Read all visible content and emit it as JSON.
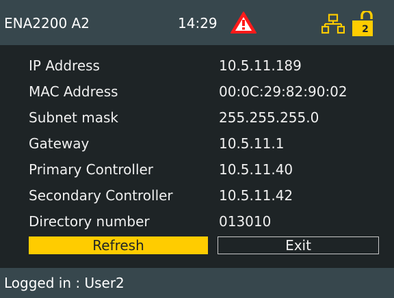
{
  "header": {
    "device_name": "ENA2200 A2",
    "time": "14:29",
    "icons": {
      "warning": "warning-icon",
      "network": "network-icon",
      "lock": "lock-icon"
    },
    "lock_level": "2"
  },
  "network_info": {
    "rows": [
      {
        "label": "IP Address",
        "value": "10.5.11.189"
      },
      {
        "label": "MAC Address",
        "value": "00:0C:29:82:90:02"
      },
      {
        "label": "Subnet mask",
        "value": "255.255.255.0"
      },
      {
        "label": "Gateway",
        "value": "10.5.11.1"
      },
      {
        "label": "Primary Controller",
        "value": "10.5.11.40"
      },
      {
        "label": "Secondary Controller",
        "value": "10.5.11.42"
      },
      {
        "label": "Directory number",
        "value": "013010"
      }
    ]
  },
  "buttons": {
    "refresh_label": "Refresh",
    "exit_label": "Exit"
  },
  "footer": {
    "status": "Logged in : User2"
  },
  "colors": {
    "background": "#1e2426",
    "bar": "#37474d",
    "accent": "#ffcc00",
    "warning": "#ff1a1a"
  }
}
